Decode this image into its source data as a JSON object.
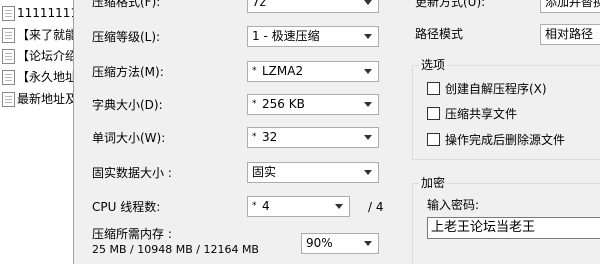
{
  "file_list": [
    "11111111",
    "【来了就能",
    "【论坛介绍",
    "【永久地址",
    "最新地址及"
  ],
  "options": {
    "archive_format": {
      "label": "压缩格式(F):",
      "value": "7z"
    },
    "compression_level": {
      "label": "压缩等级(L):",
      "value": "1 - 极速压缩"
    },
    "compression_method": {
      "label": "压缩方法(M):",
      "value": "LZMA2"
    },
    "dictionary_size": {
      "label": "字典大小(D):",
      "value": "256 KB"
    },
    "word_size": {
      "label": "单词大小(W):",
      "value": "32"
    },
    "solid_block_size": {
      "label": "固实数据大小 :",
      "value": "固实"
    },
    "cpu_threads": {
      "label": "CPU 线程数:",
      "value": "4",
      "max": "/ 4"
    },
    "memory_usage": {
      "label": "压缩所需内存 :",
      "detail": "25 MB / 10948 MB / 12164 MB",
      "value": "90%"
    }
  },
  "right": {
    "update_mode": {
      "label": "更新方式(U):",
      "value": "添加并替换"
    },
    "path_mode": {
      "label": "路径模式",
      "value": "相对路径"
    },
    "options_group": {
      "title": "选项",
      "items": [
        "创建自解压程序(X)",
        "压缩共享文件",
        "操作完成后删除源文件"
      ]
    },
    "encryption_group": {
      "title": "加密",
      "password_label": "输入密码:",
      "password_value": "上老王论坛当老王"
    }
  }
}
